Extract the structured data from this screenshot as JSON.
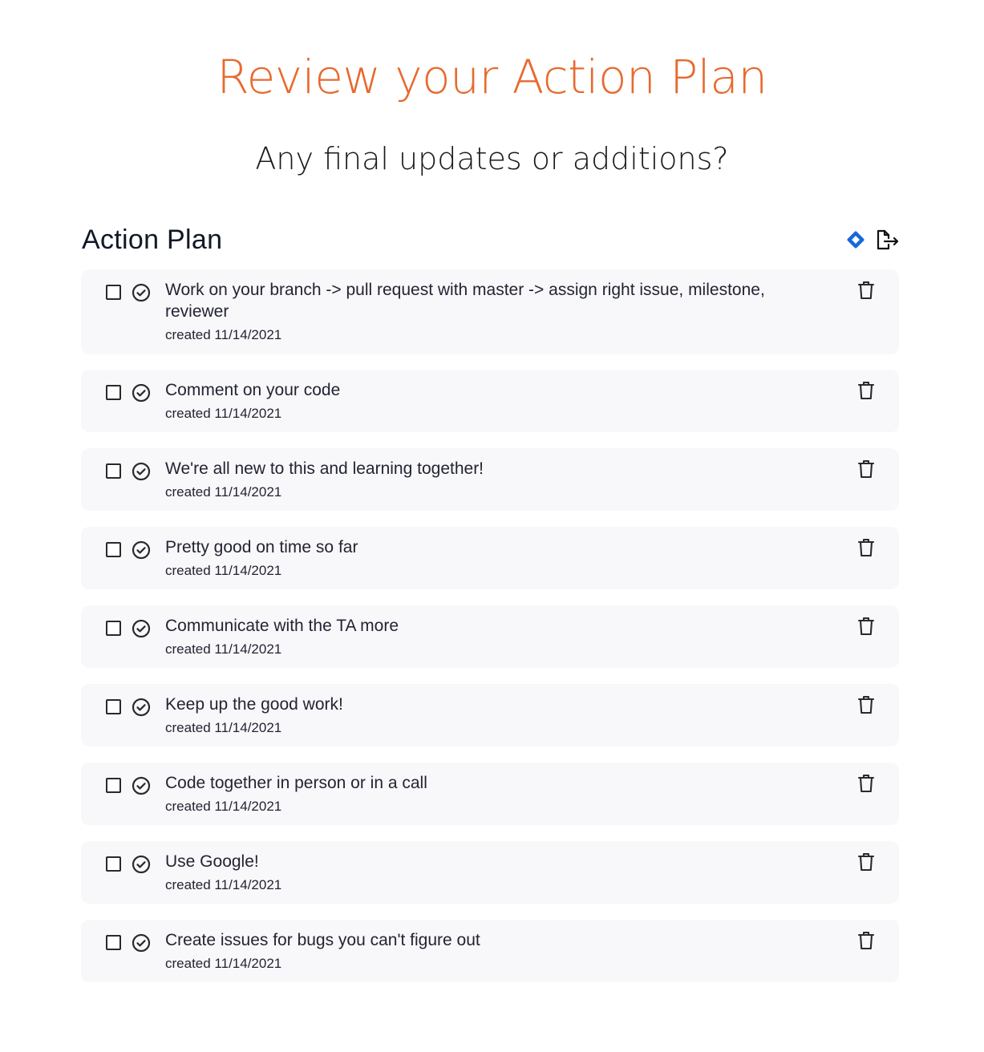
{
  "page": {
    "title": "Review your Action Plan",
    "subtitle": "Any final updates or additions?"
  },
  "action_plan": {
    "heading": "Action Plan",
    "icons": [
      "jira-icon",
      "export-icon"
    ],
    "items": [
      {
        "text": "Work on your branch -> pull request with master -> assign right issue, milestone, reviewer",
        "date": "created 11/14/2021"
      },
      {
        "text": "Comment on your code",
        "date": "created 11/14/2021"
      },
      {
        "text": "We're all new to this and learning together!",
        "date": "created 11/14/2021"
      },
      {
        "text": "Pretty good on time so far",
        "date": "created 11/14/2021"
      },
      {
        "text": "Communicate with the TA more",
        "date": "created 11/14/2021"
      },
      {
        "text": "Keep up the good work!",
        "date": "created 11/14/2021"
      },
      {
        "text": "Code together in person or in a call",
        "date": "created 11/14/2021"
      },
      {
        "text": "Use Google!",
        "date": "created 11/14/2021"
      },
      {
        "text": "Create issues for bugs you can't figure out",
        "date": "created 11/14/2021"
      }
    ]
  },
  "colors": {
    "title": "#e8692e",
    "jira_blue": "#1868db",
    "card_bg": "#f8f8fa"
  }
}
